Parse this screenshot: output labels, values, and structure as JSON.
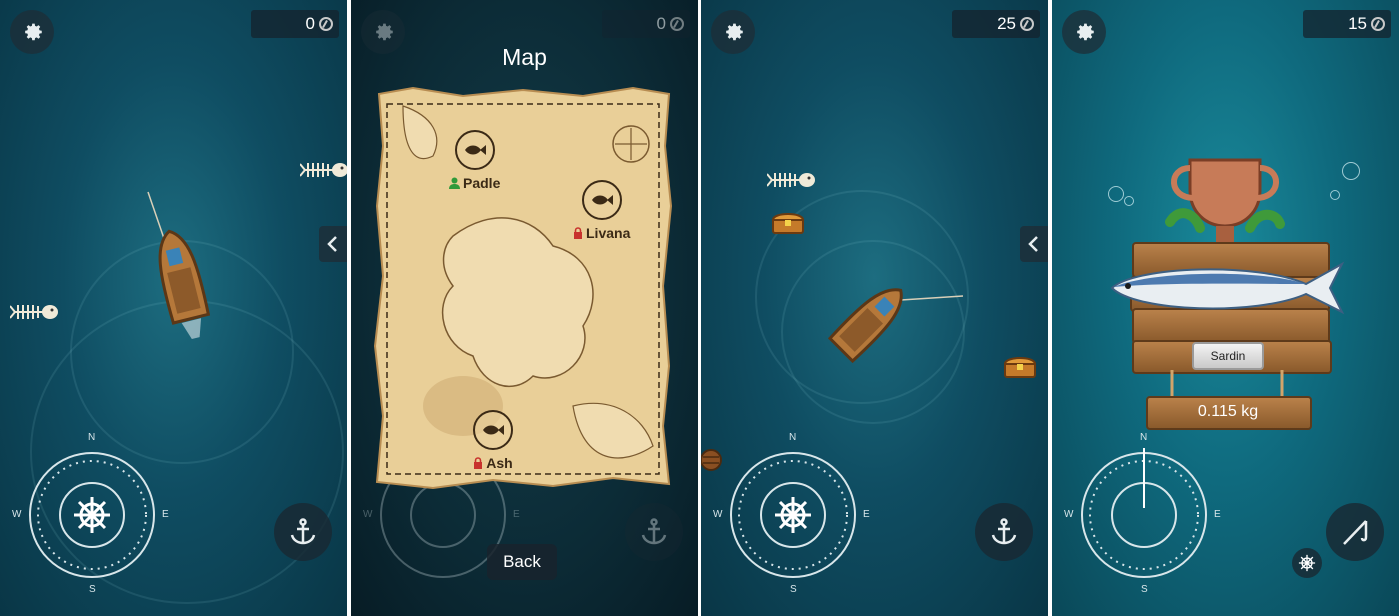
{
  "panels": [
    {
      "id": "ocean-view-1",
      "coins": "0"
    },
    {
      "id": "map-view",
      "coins": "0"
    },
    {
      "id": "ocean-view-2",
      "coins": "25"
    },
    {
      "id": "catch-result",
      "coins": "15"
    }
  ],
  "compass": {
    "n": "N",
    "s": "S",
    "e": "E",
    "w": "W"
  },
  "map": {
    "title": "Map",
    "back_label": "Back",
    "regions": [
      {
        "name": "Padle",
        "status": "unlocked"
      },
      {
        "name": "Livana",
        "status": "locked"
      },
      {
        "name": "Ash",
        "status": "locked"
      }
    ]
  },
  "catch": {
    "fish_name": "Sardin",
    "weight": "0.115 kg"
  },
  "icons": {
    "settings": "gear-icon",
    "coin": "coin-icon",
    "anchor": "anchor-icon",
    "steering": "ship-wheel-icon",
    "arrow": "chevron-left-icon",
    "fish": "fish-icon",
    "lock": "lock-icon",
    "person": "person-icon",
    "rod": "fishing-rod-icon"
  },
  "colors": {
    "ocean": "#0f4d62",
    "parchment": "#e9cf98",
    "ink": "#3b2a16",
    "lock": "#c8332d",
    "unlocked": "#2f9a3a"
  }
}
